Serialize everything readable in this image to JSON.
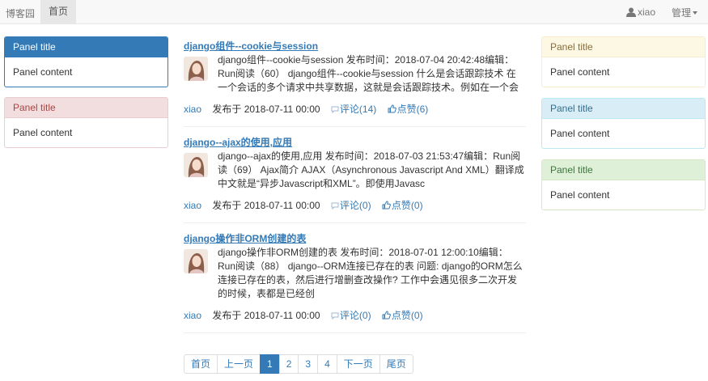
{
  "navbar": {
    "brand": "博客园",
    "home": "首页",
    "user": "xiao",
    "manage": "管理"
  },
  "left_panels": [
    {
      "title": "Panel title",
      "content": "Panel content"
    },
    {
      "title": "Panel title",
      "content": "Panel content"
    }
  ],
  "right_panels": [
    {
      "title": "Panel title",
      "content": "Panel content"
    },
    {
      "title": "Panel title",
      "content": "Panel content"
    },
    {
      "title": "Panel title",
      "content": "Panel content"
    }
  ],
  "articles": [
    {
      "title": "django组件--cookie与session",
      "summary": "django组件--cookie与session 发布时间：2018-07-04 20:42:48编辑：Run阅读（60） django组件--cookie与session 什么是会话跟踪技术 在一个会话的多个请求中共享数据，这就是会话跟踪技术。例如在一个会",
      "author": "xiao",
      "date": "发布于 2018-07-11 00:00",
      "comments": "评论(14)",
      "likes": "点赞(6)"
    },
    {
      "title": "django--ajax的使用,应用",
      "summary": "django--ajax的使用,应用 发布时间：2018-07-03 21:53:47编辑：Run阅读（69） Ajax简介 AJAX（Asynchronous Javascript And XML）翻译成中文就是“异步Javascript和XML”。即使用Javasc",
      "author": "xiao",
      "date": "发布于 2018-07-11 00:00",
      "comments": "评论(0)",
      "likes": "点赞(0)"
    },
    {
      "title": "django操作非ORM创建的表",
      "summary": "django操作非ORM创建的表 发布时间：2018-07-01 12:00:10编辑：Run阅读（88） django--ORM连接已存在的表 问题: django的ORM怎么连接已存在的表，然后进行增删查改操作? 工作中会遇见很多二次开发的时候，表都是已经创",
      "author": "xiao",
      "date": "发布于 2018-07-11 00:00",
      "comments": "评论(0)",
      "likes": "点赞(0)"
    }
  ],
  "pagination": {
    "first": "首页",
    "prev": "上一页",
    "pages": [
      "1",
      "2",
      "3",
      "4"
    ],
    "next": "下一页",
    "last": "尾页",
    "active_page": "1"
  },
  "colors": {
    "primary": "#337ab7",
    "danger_bg": "#f2dede",
    "warning_bg": "#fcf8e3",
    "info_bg": "#d9edf7",
    "success_bg": "#dff0d8"
  }
}
